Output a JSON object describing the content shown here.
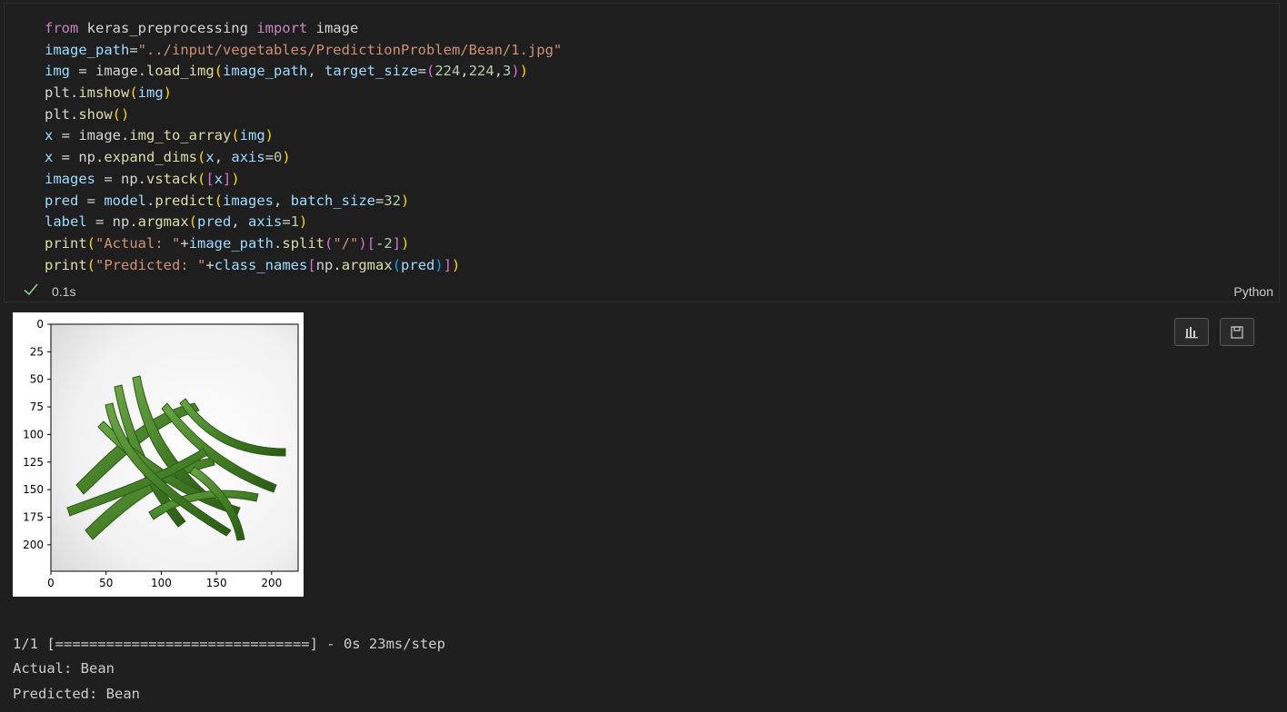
{
  "cell": {
    "code_lines": [
      [
        [
          "kw",
          "from"
        ],
        [
          "plain",
          " keras_preprocessing "
        ],
        [
          "kw",
          "import"
        ],
        [
          "plain",
          " image"
        ]
      ],
      [
        [
          "var",
          "image_path"
        ],
        [
          "plain",
          "="
        ],
        [
          "str",
          "\"../input/vegetables/PredictionProblem/Bean/1.jpg\""
        ]
      ],
      [
        [
          "var",
          "img"
        ],
        [
          "plain",
          " = image."
        ],
        [
          "fn",
          "load_img"
        ],
        [
          "p1",
          "("
        ],
        [
          "var",
          "image_path"
        ],
        [
          "plain",
          ", "
        ],
        [
          "var",
          "target_size"
        ],
        [
          "plain",
          "="
        ],
        [
          "p2",
          "("
        ],
        [
          "num",
          "224"
        ],
        [
          "plain",
          ","
        ],
        [
          "num",
          "224"
        ],
        [
          "plain",
          ","
        ],
        [
          "num",
          "3"
        ],
        [
          "p2",
          ")"
        ],
        [
          "p1",
          ")"
        ]
      ],
      [
        [
          "plain",
          "plt."
        ],
        [
          "fn",
          "imshow"
        ],
        [
          "p1",
          "("
        ],
        [
          "var",
          "img"
        ],
        [
          "p1",
          ")"
        ]
      ],
      [
        [
          "plain",
          "plt."
        ],
        [
          "fn",
          "show"
        ],
        [
          "p1",
          "()"
        ]
      ],
      [
        [
          "var",
          "x"
        ],
        [
          "plain",
          " = image."
        ],
        [
          "fn",
          "img_to_array"
        ],
        [
          "p1",
          "("
        ],
        [
          "var",
          "img"
        ],
        [
          "p1",
          ")"
        ]
      ],
      [
        [
          "var",
          "x"
        ],
        [
          "plain",
          " = np."
        ],
        [
          "fn",
          "expand_dims"
        ],
        [
          "p1",
          "("
        ],
        [
          "var",
          "x"
        ],
        [
          "plain",
          ", "
        ],
        [
          "var",
          "axis"
        ],
        [
          "plain",
          "="
        ],
        [
          "num",
          "0"
        ],
        [
          "p1",
          ")"
        ]
      ],
      [
        [
          "var",
          "images"
        ],
        [
          "plain",
          " = np."
        ],
        [
          "fn",
          "vstack"
        ],
        [
          "p1",
          "("
        ],
        [
          "p2",
          "["
        ],
        [
          "var",
          "x"
        ],
        [
          "p2",
          "]"
        ],
        [
          "p1",
          ")"
        ]
      ],
      [
        [
          "var",
          "pred"
        ],
        [
          "plain",
          " = "
        ],
        [
          "var",
          "model"
        ],
        [
          "plain",
          "."
        ],
        [
          "fn",
          "predict"
        ],
        [
          "p1",
          "("
        ],
        [
          "var",
          "images"
        ],
        [
          "plain",
          ", "
        ],
        [
          "var",
          "batch_size"
        ],
        [
          "plain",
          "="
        ],
        [
          "num",
          "32"
        ],
        [
          "p1",
          ")"
        ]
      ],
      [
        [
          "var",
          "label"
        ],
        [
          "plain",
          " = np."
        ],
        [
          "fn",
          "argmax"
        ],
        [
          "p1",
          "("
        ],
        [
          "var",
          "pred"
        ],
        [
          "plain",
          ", "
        ],
        [
          "var",
          "axis"
        ],
        [
          "plain",
          "="
        ],
        [
          "num",
          "1"
        ],
        [
          "p1",
          ")"
        ]
      ],
      [
        [
          "fn",
          "print"
        ],
        [
          "p1",
          "("
        ],
        [
          "str",
          "\"Actual: \""
        ],
        [
          "plain",
          "+"
        ],
        [
          "var",
          "image_path"
        ],
        [
          "plain",
          "."
        ],
        [
          "fn",
          "split"
        ],
        [
          "p2",
          "("
        ],
        [
          "str",
          "\"/\""
        ],
        [
          "p2",
          ")"
        ],
        [
          "p2",
          "["
        ],
        [
          "plain",
          "-"
        ],
        [
          "num",
          "2"
        ],
        [
          "p2",
          "]"
        ],
        [
          "p1",
          ")"
        ]
      ],
      [
        [
          "fn",
          "print"
        ],
        [
          "p1",
          "("
        ],
        [
          "str",
          "\"Predicted: \""
        ],
        [
          "plain",
          "+"
        ],
        [
          "var",
          "class_names"
        ],
        [
          "p2",
          "["
        ],
        [
          "plain",
          "np."
        ],
        [
          "fn",
          "argmax"
        ],
        [
          "p3",
          "("
        ],
        [
          "var",
          "pred"
        ],
        [
          "p3",
          ")"
        ],
        [
          "p2",
          "]"
        ],
        [
          "p1",
          ")"
        ]
      ]
    ],
    "status": {
      "check_icon": "check-icon",
      "exec_time": "0.1s",
      "language": "Python"
    }
  },
  "output": {
    "plot": {
      "y_ticks": [
        "0",
        "25",
        "50",
        "75",
        "100",
        "125",
        "150",
        "175",
        "200"
      ],
      "x_ticks": [
        "0",
        "50",
        "100",
        "150",
        "200"
      ],
      "image_subject": "green beans"
    },
    "toolbar": {
      "chart_icon": "bar-chart-icon",
      "save_icon": "save-icon"
    },
    "text_lines": [
      "1/1 [==============================] - 0s 23ms/step",
      "Actual: Bean",
      "Predicted: Bean"
    ]
  },
  "colors": {
    "keyword": "#c586c0",
    "function": "#dcdcaa",
    "variable": "#9cdcfe",
    "string": "#ce9178",
    "number": "#b5cea8",
    "check": "#89d185"
  }
}
